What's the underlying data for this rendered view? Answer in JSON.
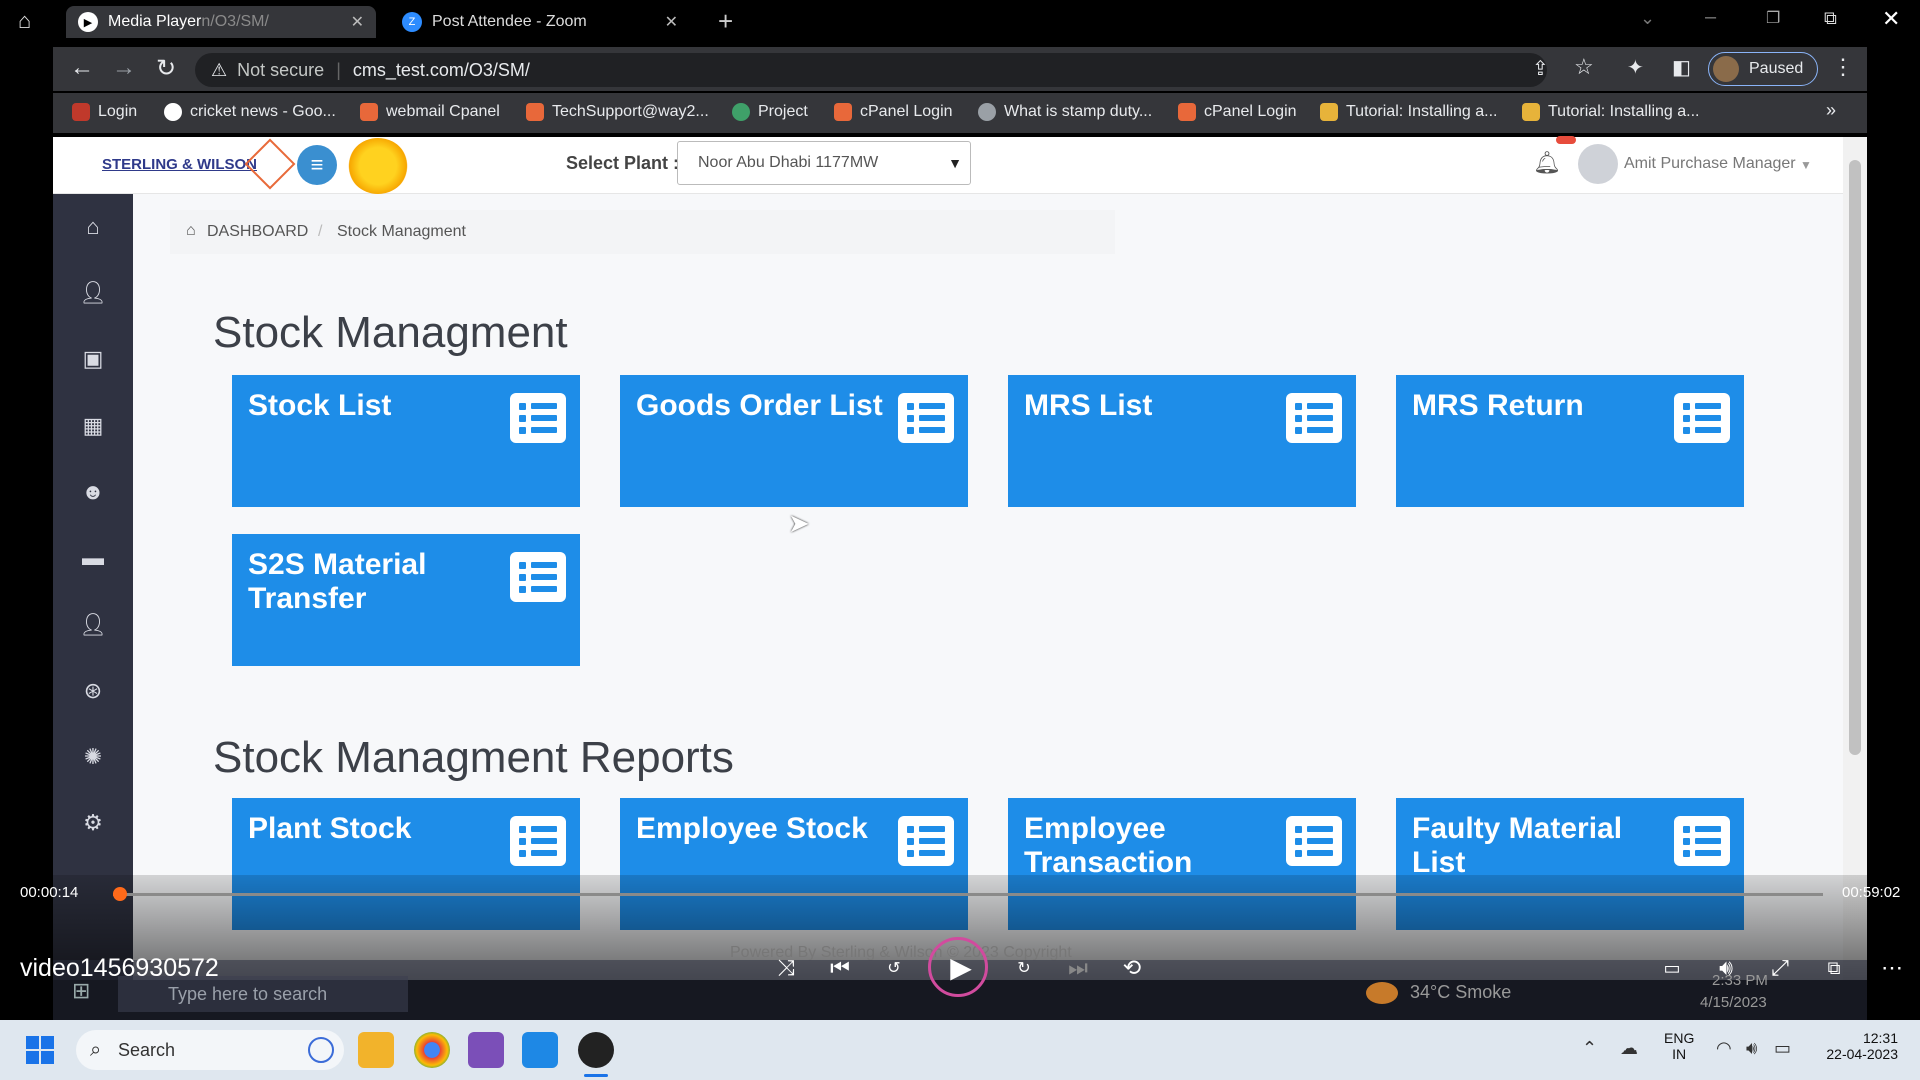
{
  "tabs": [
    {
      "label": "Media Player",
      "suffix": "n/O3/SM/",
      "active": true
    },
    {
      "label": "Post Attendee - Zoom",
      "active": false
    }
  ],
  "address": {
    "security": "Not secure",
    "url": "cms_test.com/O3/SM/"
  },
  "profile": {
    "status": "Paused"
  },
  "bookmarks": [
    {
      "label": "Login",
      "color": "#c0392b"
    },
    {
      "label": "cricket news - Goo...",
      "color": "#ffffff"
    },
    {
      "label": "webmail Cpanel",
      "color": "#e8683a"
    },
    {
      "label": "TechSupport@way2...",
      "color": "#e8683a"
    },
    {
      "label": "Project",
      "color": "#3fa069"
    },
    {
      "label": "cPanel Login",
      "color": "#e8683a"
    },
    {
      "label": "What is stamp duty...",
      "color": "#9aa0a6"
    },
    {
      "label": "cPanel Login",
      "color": "#e8683a"
    },
    {
      "label": "Tutorial: Installing a...",
      "color": "#e7b33a"
    },
    {
      "label": "Tutorial: Installing a...",
      "color": "#e7b33a"
    }
  ],
  "header": {
    "logo": "STERLING & WILSON",
    "plant_label": "Select Plant :",
    "plant_value": "Noor Abu Dhabi 1177MW",
    "user": "Amit Purchase Manager"
  },
  "breadcrumb": {
    "home": "DASHBOARD",
    "current": "Stock Managment"
  },
  "section1": {
    "title": "Stock Managment",
    "tiles": [
      "Stock List",
      "Goods Order List",
      "MRS List",
      "MRS Return",
      "S2S Material Transfer"
    ]
  },
  "section2": {
    "title": "Stock Managment Reports",
    "tiles": [
      "Plant Stock",
      "Employee Stock",
      "Employee Transaction",
      "Faulty Material List"
    ]
  },
  "footer_text": "Powered By Sterling & Wilson © 2023 Copyright",
  "player": {
    "elapsed": "00:00:14",
    "total": "00:59:02",
    "title": "video1456930572",
    "progress_fraction": 0.004
  },
  "inner_taskbar": {
    "search": "Type here to search",
    "weather": "34°C  Smoke",
    "time": "2:33 PM",
    "date": "4/15/2023"
  },
  "taskbar": {
    "search": "Search",
    "lang1": "ENG",
    "lang2": "IN",
    "time": "12:31",
    "date": "22-04-2023"
  },
  "colors": {
    "accent": "#1e8de8",
    "sidebar": "#2f3241"
  }
}
